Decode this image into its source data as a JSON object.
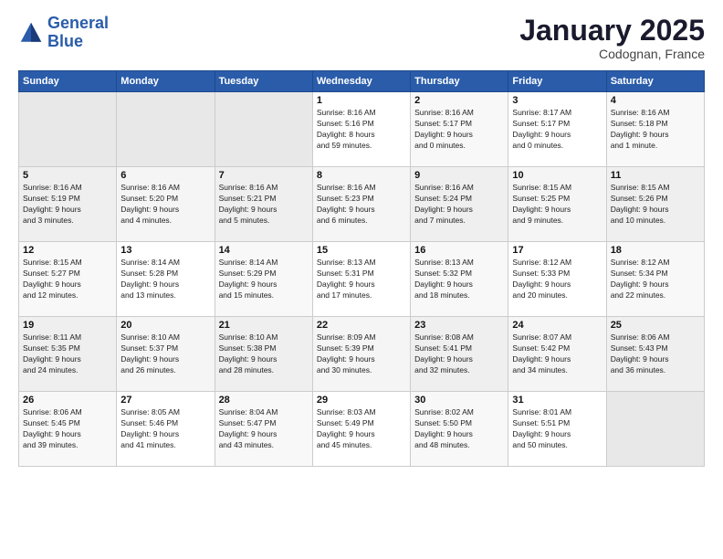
{
  "header": {
    "logo_general": "General",
    "logo_blue": "Blue",
    "month": "January 2025",
    "location": "Codognan, France"
  },
  "days_of_week": [
    "Sunday",
    "Monday",
    "Tuesday",
    "Wednesday",
    "Thursday",
    "Friday",
    "Saturday"
  ],
  "weeks": [
    [
      {
        "day": "",
        "info": ""
      },
      {
        "day": "",
        "info": ""
      },
      {
        "day": "",
        "info": ""
      },
      {
        "day": "1",
        "info": "Sunrise: 8:16 AM\nSunset: 5:16 PM\nDaylight: 8 hours\nand 59 minutes."
      },
      {
        "day": "2",
        "info": "Sunrise: 8:16 AM\nSunset: 5:17 PM\nDaylight: 9 hours\nand 0 minutes."
      },
      {
        "day": "3",
        "info": "Sunrise: 8:17 AM\nSunset: 5:17 PM\nDaylight: 9 hours\nand 0 minutes."
      },
      {
        "day": "4",
        "info": "Sunrise: 8:16 AM\nSunset: 5:18 PM\nDaylight: 9 hours\nand 1 minute."
      }
    ],
    [
      {
        "day": "5",
        "info": "Sunrise: 8:16 AM\nSunset: 5:19 PM\nDaylight: 9 hours\nand 3 minutes."
      },
      {
        "day": "6",
        "info": "Sunrise: 8:16 AM\nSunset: 5:20 PM\nDaylight: 9 hours\nand 4 minutes."
      },
      {
        "day": "7",
        "info": "Sunrise: 8:16 AM\nSunset: 5:21 PM\nDaylight: 9 hours\nand 5 minutes."
      },
      {
        "day": "8",
        "info": "Sunrise: 8:16 AM\nSunset: 5:23 PM\nDaylight: 9 hours\nand 6 minutes."
      },
      {
        "day": "9",
        "info": "Sunrise: 8:16 AM\nSunset: 5:24 PM\nDaylight: 9 hours\nand 7 minutes."
      },
      {
        "day": "10",
        "info": "Sunrise: 8:15 AM\nSunset: 5:25 PM\nDaylight: 9 hours\nand 9 minutes."
      },
      {
        "day": "11",
        "info": "Sunrise: 8:15 AM\nSunset: 5:26 PM\nDaylight: 9 hours\nand 10 minutes."
      }
    ],
    [
      {
        "day": "12",
        "info": "Sunrise: 8:15 AM\nSunset: 5:27 PM\nDaylight: 9 hours\nand 12 minutes."
      },
      {
        "day": "13",
        "info": "Sunrise: 8:14 AM\nSunset: 5:28 PM\nDaylight: 9 hours\nand 13 minutes."
      },
      {
        "day": "14",
        "info": "Sunrise: 8:14 AM\nSunset: 5:29 PM\nDaylight: 9 hours\nand 15 minutes."
      },
      {
        "day": "15",
        "info": "Sunrise: 8:13 AM\nSunset: 5:31 PM\nDaylight: 9 hours\nand 17 minutes."
      },
      {
        "day": "16",
        "info": "Sunrise: 8:13 AM\nSunset: 5:32 PM\nDaylight: 9 hours\nand 18 minutes."
      },
      {
        "day": "17",
        "info": "Sunrise: 8:12 AM\nSunset: 5:33 PM\nDaylight: 9 hours\nand 20 minutes."
      },
      {
        "day": "18",
        "info": "Sunrise: 8:12 AM\nSunset: 5:34 PM\nDaylight: 9 hours\nand 22 minutes."
      }
    ],
    [
      {
        "day": "19",
        "info": "Sunrise: 8:11 AM\nSunset: 5:35 PM\nDaylight: 9 hours\nand 24 minutes."
      },
      {
        "day": "20",
        "info": "Sunrise: 8:10 AM\nSunset: 5:37 PM\nDaylight: 9 hours\nand 26 minutes."
      },
      {
        "day": "21",
        "info": "Sunrise: 8:10 AM\nSunset: 5:38 PM\nDaylight: 9 hours\nand 28 minutes."
      },
      {
        "day": "22",
        "info": "Sunrise: 8:09 AM\nSunset: 5:39 PM\nDaylight: 9 hours\nand 30 minutes."
      },
      {
        "day": "23",
        "info": "Sunrise: 8:08 AM\nSunset: 5:41 PM\nDaylight: 9 hours\nand 32 minutes."
      },
      {
        "day": "24",
        "info": "Sunrise: 8:07 AM\nSunset: 5:42 PM\nDaylight: 9 hours\nand 34 minutes."
      },
      {
        "day": "25",
        "info": "Sunrise: 8:06 AM\nSunset: 5:43 PM\nDaylight: 9 hours\nand 36 minutes."
      }
    ],
    [
      {
        "day": "26",
        "info": "Sunrise: 8:06 AM\nSunset: 5:45 PM\nDaylight: 9 hours\nand 39 minutes."
      },
      {
        "day": "27",
        "info": "Sunrise: 8:05 AM\nSunset: 5:46 PM\nDaylight: 9 hours\nand 41 minutes."
      },
      {
        "day": "28",
        "info": "Sunrise: 8:04 AM\nSunset: 5:47 PM\nDaylight: 9 hours\nand 43 minutes."
      },
      {
        "day": "29",
        "info": "Sunrise: 8:03 AM\nSunset: 5:49 PM\nDaylight: 9 hours\nand 45 minutes."
      },
      {
        "day": "30",
        "info": "Sunrise: 8:02 AM\nSunset: 5:50 PM\nDaylight: 9 hours\nand 48 minutes."
      },
      {
        "day": "31",
        "info": "Sunrise: 8:01 AM\nSunset: 5:51 PM\nDaylight: 9 hours\nand 50 minutes."
      },
      {
        "day": "",
        "info": ""
      }
    ]
  ]
}
